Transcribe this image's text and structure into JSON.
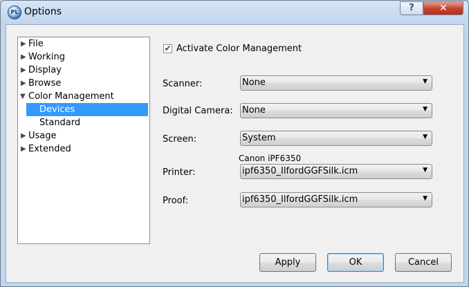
{
  "window": {
    "title": "Options",
    "app_icon": "PL"
  },
  "caption_buttons": {
    "help": "?",
    "close": "✕"
  },
  "tree": {
    "items": [
      {
        "label": "File",
        "expander": "▶"
      },
      {
        "label": "Working",
        "expander": "▶"
      },
      {
        "label": "Display",
        "expander": "▶"
      },
      {
        "label": "Browse",
        "expander": "▶"
      },
      {
        "label": "Color Management",
        "expander": "▼"
      },
      {
        "label": "Devices",
        "selected": true
      },
      {
        "label": "Standard"
      },
      {
        "label": "Usage",
        "expander": "▶"
      },
      {
        "label": "Extended",
        "expander": "▶"
      }
    ]
  },
  "color_management": {
    "activate_label": "Activate Color Management",
    "activate_checked": true,
    "check_glyph": "✔"
  },
  "fields": {
    "scanner": {
      "label": "Scanner:",
      "value": "None"
    },
    "camera": {
      "label": "Digital Camera:",
      "value": "None"
    },
    "screen": {
      "label": "Screen:",
      "value": "System"
    },
    "printer": {
      "label": "Printer:",
      "value": "ipf6350_IlfordGGFSilk.icm",
      "device_name": "Canon iPF6350"
    },
    "proof": {
      "label": "Proof:",
      "value": "ipf6350_IlfordGGFSilk.icm"
    }
  },
  "dropdown_glyph": "▼",
  "buttons": {
    "apply": "Apply",
    "ok": "OK",
    "cancel": "Cancel"
  },
  "colors": {
    "selection": "#3399ff",
    "dialog_bg": "#f0f0f0",
    "close_button": "#c4402a"
  }
}
